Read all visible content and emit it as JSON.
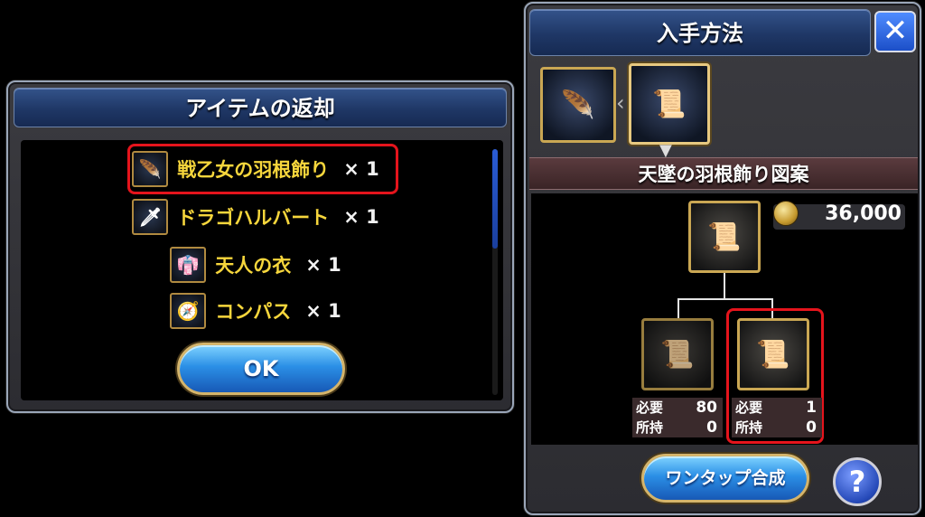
{
  "left_panel": {
    "title": "アイテムの返却",
    "items": [
      {
        "icon": "feather-ornament-icon",
        "name": "戦乙女の羽根飾り",
        "qty": "× 1",
        "highlighted": true
      },
      {
        "icon": "halberd-icon",
        "name": "ドラゴハルバート",
        "qty": "× 1",
        "highlighted": false
      },
      {
        "icon": "robe-icon",
        "name": "天人の衣",
        "qty": "× 1",
        "highlighted": false
      },
      {
        "icon": "compass-icon",
        "name": "コンパス",
        "qty": "× 1",
        "highlighted": false
      }
    ],
    "ok_label": "OK",
    "colors": {
      "item_name": "#f6d63c",
      "highlight": "#e5141c",
      "scroll_thumb": "#2a5cd6"
    }
  },
  "right_panel": {
    "title": "入手方法",
    "close_icon": "close-icon",
    "recipe_name": "天墜の羽根飾り図案",
    "cost": "36,000",
    "materials": [
      {
        "icon": "recipe-scroll-icon",
        "required_label": "必要",
        "required": "80",
        "owned_label": "所持",
        "owned": "0",
        "highlighted": false
      },
      {
        "icon": "recipe-scroll-feather-icon",
        "required_label": "必要",
        "required": "1",
        "owned_label": "所持",
        "owned": "0",
        "highlighted": true
      }
    ],
    "onetap_label": "ワンタップ合成",
    "help_label": "?"
  }
}
